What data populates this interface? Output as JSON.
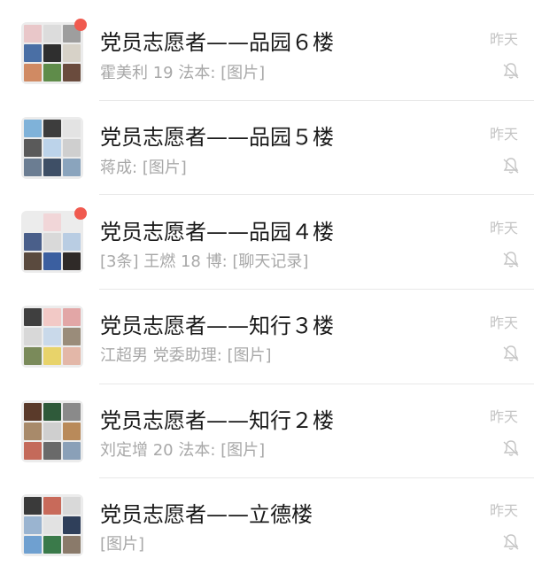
{
  "chats": [
    {
      "title": "党员志愿者——品园６楼",
      "preview": "霍美利 19 法本: [图片]",
      "time": "昨天",
      "unread_dot": true,
      "muted": true,
      "avatar_colors": [
        "#e9c7c9",
        "#dcdcdc",
        "#9e9e9e",
        "#4a6fa5",
        "#2f2f2f",
        "#d7d2c8",
        "#d08a63",
        "#5f8c4a",
        "#6a4b3d"
      ]
    },
    {
      "title": "党员志愿者——品园５楼",
      "preview": "蒋成: [图片]",
      "time": "昨天",
      "unread_dot": false,
      "muted": true,
      "avatar_colors": [
        "#7fb2d9",
        "#3d3d3d",
        "#e3e3e3",
        "#5a5a5a",
        "#bcd3ea",
        "#cfcfcf",
        "#6b7d92",
        "#3e4f66",
        "#8aa4bd"
      ]
    },
    {
      "title": "党员志愿者——品园４楼",
      "preview": "[3条] 王燃 18 博: [聊天记录]",
      "time": "昨天",
      "unread_dot": true,
      "muted": true,
      "avatar_colors": [
        "#ececec",
        "#f1d6d8",
        "#ececec",
        "#4a5f8a",
        "#d9d9d9",
        "#b9cde3",
        "#5a4a3e",
        "#3b5fa0",
        "#2f2a28"
      ]
    },
    {
      "title": "党员志愿者——知行３楼",
      "preview": "江超男 党委助理: [图片]",
      "time": "昨天",
      "unread_dot": false,
      "muted": true,
      "avatar_colors": [
        "#3f3f3f",
        "#f2c9c6",
        "#e2a6a6",
        "#d8d8d8",
        "#c9d9ea",
        "#9a8c7a",
        "#7a8a5a",
        "#e8d36a",
        "#e3b7a8"
      ]
    },
    {
      "title": "党员志愿者——知行２楼",
      "preview": "刘定增 20 法本: [图片]",
      "time": "昨天",
      "unread_dot": false,
      "muted": true,
      "avatar_colors": [
        "#5a3a2a",
        "#2f5a3a",
        "#8a8a8a",
        "#a88a6a",
        "#cfcfcf",
        "#b98a5a",
        "#c46a5a",
        "#6a6a6a",
        "#8aa0b8"
      ]
    },
    {
      "title": "党员志愿者——立德楼",
      "preview": "[图片]",
      "time": "昨天",
      "unread_dot": false,
      "muted": true,
      "avatar_colors": [
        "#3a3a3a",
        "#c86a5a",
        "#d9d9d9",
        "#9ab4d0",
        "#e2e2e2",
        "#2f3f5a",
        "#6fa0d0",
        "#3a7a4a",
        "#8a7a6a"
      ]
    }
  ]
}
